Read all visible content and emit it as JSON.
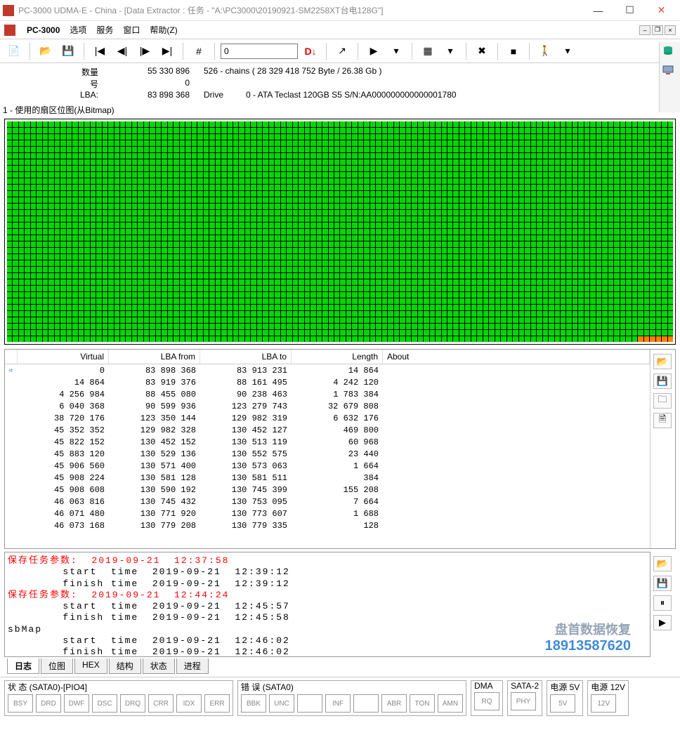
{
  "window": {
    "title": "PC-3000 UDMA-E - China - [Data Extractor : 任务 - \"A:\\PC3000\\20190921-SM2258XT台电128G\"]"
  },
  "menubar": {
    "appname": "PC-3000",
    "items": [
      "选项",
      "服务",
      "窗口",
      "帮助(Z)"
    ]
  },
  "toolbar": {
    "input_value": "0",
    "d_label": "D↓"
  },
  "info": {
    "qty_label": "数量",
    "qty_value": "55 330 896",
    "qty_extra": "526 - chains  ( 28 329 418 752 Byte /   26.38 Gb )",
    "num_label": "号",
    "num_value": "0",
    "lba_label": "LBA:",
    "lba_value": "83 898 368",
    "drive_label": "Drive",
    "drive_value": "0 - ATA Teclast 120GB S5  S/N:AA000000000000001780"
  },
  "bitmap": {
    "title": "1 - 使用的扇区位图(从Bitmap)"
  },
  "table": {
    "columns": {
      "virtual": "Virtual",
      "lbafrom": "LBA from",
      "lbato": "LBA to",
      "length": "Length",
      "about": "About"
    },
    "rows": [
      {
        "virtual": "0",
        "lbafrom": "83 898 368",
        "lbato": "83 913 231",
        "length": "14 864",
        "sel": true
      },
      {
        "virtual": "14 864",
        "lbafrom": "83 919 376",
        "lbato": "88 161 495",
        "length": "4 242 120"
      },
      {
        "virtual": "4 256 984",
        "lbafrom": "88 455 080",
        "lbato": "90 238 463",
        "length": "1 783 384"
      },
      {
        "virtual": "6 040 368",
        "lbafrom": "90 599 936",
        "lbato": "123 279 743",
        "length": "32 679 808"
      },
      {
        "virtual": "38 720 176",
        "lbafrom": "123 350 144",
        "lbato": "129 982 319",
        "length": "6 632 176"
      },
      {
        "virtual": "45 352 352",
        "lbafrom": "129 982 328",
        "lbato": "130 452 127",
        "length": "469 800"
      },
      {
        "virtual": "45 822 152",
        "lbafrom": "130 452 152",
        "lbato": "130 513 119",
        "length": "60 968"
      },
      {
        "virtual": "45 883 120",
        "lbafrom": "130 529 136",
        "lbato": "130 552 575",
        "length": "23 440"
      },
      {
        "virtual": "45 906 560",
        "lbafrom": "130 571 400",
        "lbato": "130 573 063",
        "length": "1 664"
      },
      {
        "virtual": "45 908 224",
        "lbafrom": "130 581 128",
        "lbato": "130 581 511",
        "length": "384"
      },
      {
        "virtual": "45 908 608",
        "lbafrom": "130 590 192",
        "lbato": "130 745 399",
        "length": "155 208"
      },
      {
        "virtual": "46 063 816",
        "lbafrom": "130 745 432",
        "lbato": "130 753 095",
        "length": "7 664"
      },
      {
        "virtual": "46 071 480",
        "lbafrom": "130 771 920",
        "lbato": "130 773 607",
        "length": "1 688"
      },
      {
        "virtual": "46 073 168",
        "lbafrom": "130 779 208",
        "lbato": "130 779 335",
        "length": "128"
      }
    ]
  },
  "log": {
    "lines": [
      {
        "red": true,
        "text": "保存任务参数:  2019-09-21  12:37:58"
      },
      {
        "red": false,
        "text": "        start  time  2019-09-21  12:39:12"
      },
      {
        "red": false,
        "text": "        finish time  2019-09-21  12:39:12"
      },
      {
        "red": true,
        "text": "保存任务参数:  2019-09-21  12:44:24"
      },
      {
        "red": false,
        "text": "        start  time  2019-09-21  12:45:57"
      },
      {
        "red": false,
        "text": "        finish time  2019-09-21  12:45:58"
      },
      {
        "red": false,
        "text": "sbMap"
      },
      {
        "red": false,
        "text": "        start  time  2019-09-21  12:46:02"
      },
      {
        "red": false,
        "text": "        finish time  2019-09-21  12:46:02"
      }
    ]
  },
  "tabs": [
    "日志",
    "位图",
    "HEX",
    "结构",
    "状态",
    "进程"
  ],
  "status": {
    "sata": {
      "title": "状 态 (SATA0)-[PIO4]",
      "boxes": [
        "BSY",
        "DRD",
        "DWF",
        "DSC",
        "DRQ",
        "CRR",
        "IDX",
        "ERR"
      ]
    },
    "err": {
      "title": "错 误 (SATA0)",
      "boxes": [
        "BBK",
        "UNC",
        "",
        "INF",
        "",
        "ABR",
        "TON",
        "AMN"
      ]
    },
    "dma": {
      "title": "DMA",
      "boxes": [
        "RQ"
      ]
    },
    "sata2": {
      "title": "SATA-2",
      "boxes": [
        "PHY"
      ]
    },
    "pw5": {
      "title": "电源 5V",
      "boxes": [
        "5V"
      ]
    },
    "pw12": {
      "title": "电源 12V",
      "boxes": [
        "12V"
      ]
    }
  },
  "watermark": {
    "l1": "盘首数据恢复",
    "l2": "18913587620"
  }
}
